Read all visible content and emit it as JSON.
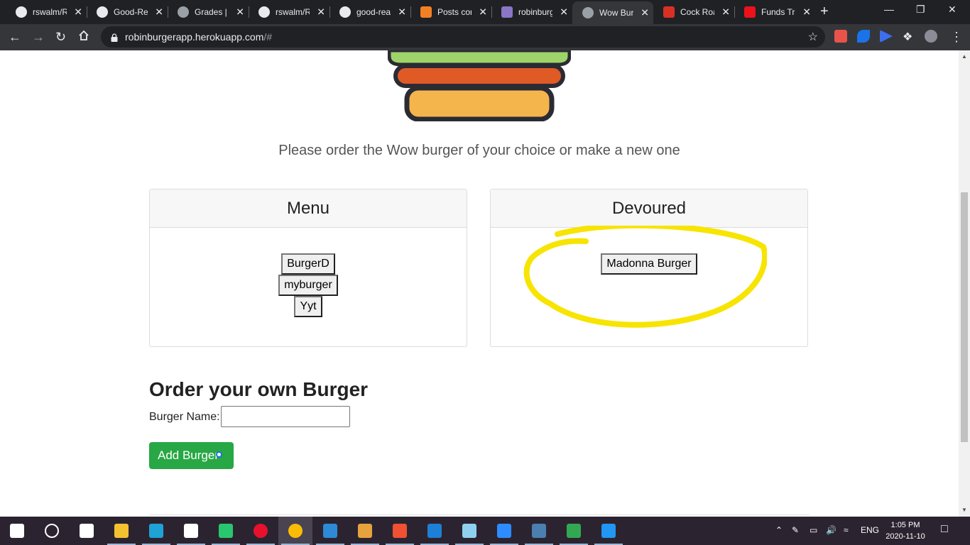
{
  "browser": {
    "tabs": [
      {
        "title": "rswalm/R",
        "icon": "github-icon"
      },
      {
        "title": "Good-Re",
        "icon": "github-icon"
      },
      {
        "title": "Grades | ",
        "icon": "globe-icon"
      },
      {
        "title": "rswalm/R",
        "icon": "github-icon"
      },
      {
        "title": "good-rea",
        "icon": "github-icon"
      },
      {
        "title": "Posts cor",
        "icon": "stackoverflow-icon"
      },
      {
        "title": "robinburg",
        "icon": "heroku-icon"
      },
      {
        "title": "Wow Bur",
        "icon": "globe-icon",
        "active": true
      },
      {
        "title": "Cock Roa",
        "icon": "gmail-icon"
      },
      {
        "title": "Funds Tra",
        "icon": "scotiabank-icon"
      }
    ],
    "url_host": "robinburgerapp.herokuapp.com",
    "url_path": "/#"
  },
  "page": {
    "intro": "Please order the Wow burger of your choice or make a new one",
    "menu": {
      "title": "Menu",
      "burgers": [
        "BurgerD",
        "myburger",
        "Yyt"
      ]
    },
    "devoured": {
      "title": "Devoured",
      "burgers": [
        "Madonna Burger"
      ]
    },
    "order": {
      "title": "Order your own Burger",
      "label": "Burger Name:",
      "input_value": "",
      "button_label": "Add Burger"
    }
  },
  "colors": {
    "lettuce": "#9ed46a",
    "tomato": "#e05a26",
    "bun": "#f5b54d",
    "outline": "#2b2b33",
    "highlight": "#f7e400",
    "add_button": "#28a745"
  },
  "taskbar": {
    "apps": [
      "windows-start-icon",
      "search-cortana-icon",
      "task-view-icon",
      "file-explorer-icon",
      "edge-icon",
      "snip-icon",
      "pycharm-icon",
      "opera-icon",
      "chrome-icon",
      "vscode-icon",
      "paint-icon",
      "git-icon",
      "photos-icon",
      "notepad-icon",
      "zoom-icon",
      "mysql-workbench-icon",
      "heidisql-icon",
      "video-editor-icon"
    ],
    "lang": "ENG",
    "time": "1:05 PM",
    "date": "2020-11-10"
  }
}
